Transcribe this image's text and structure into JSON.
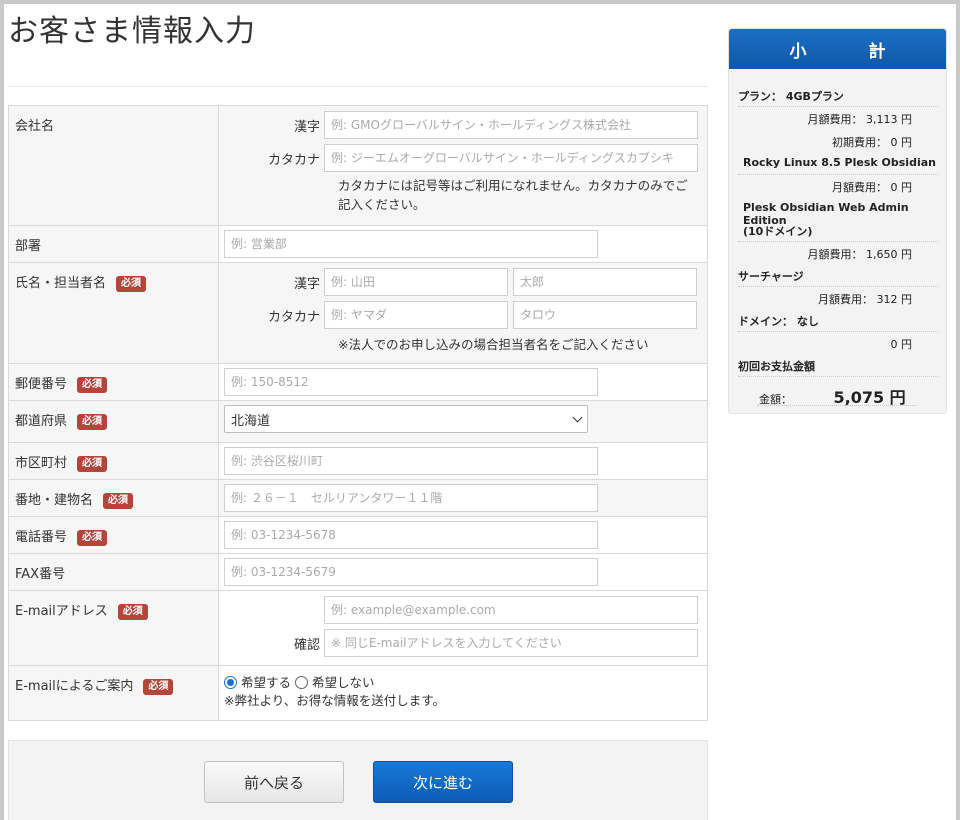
{
  "page": {
    "title": "お客さま情報入力"
  },
  "form": {
    "company": {
      "label": "会社名",
      "kanji_label": "漢字",
      "kanji_placeholder": "例: GMOグローバルサイン・ホールディングス株式会社",
      "kana_label": "カタカナ",
      "kana_placeholder": "例: ジーエムオーグローバルサイン・ホールディングスカブシキ",
      "note": "カタカナには記号等はご利用になれません。カタカナのみでご記入ください。"
    },
    "department": {
      "label": "部署",
      "placeholder": "例: 営業部"
    },
    "name": {
      "label": "氏名・担当者名",
      "required": "必須",
      "kanji_label": "漢字",
      "last_placeholder": "例: 山田",
      "first_placeholder": "太郎",
      "kana_label": "カタカナ",
      "last_kana_placeholder": "例: ヤマダ",
      "first_kana_placeholder": "タロウ",
      "note": "※法人でのお申し込みの場合担当者名をご記入ください"
    },
    "postal": {
      "label": "郵便番号",
      "required": "必須",
      "placeholder": "例: 150-8512"
    },
    "prefecture": {
      "label": "都道府県",
      "required": "必須",
      "value": "北海道"
    },
    "city": {
      "label": "市区町村",
      "required": "必須",
      "placeholder": "例: 渋谷区桜川町"
    },
    "address": {
      "label": "番地・建物名",
      "required": "必須",
      "placeholder": "例: ２６－１　セルリアンタワー１１階"
    },
    "phone": {
      "label": "電話番号",
      "required": "必須",
      "placeholder": "例: 03-1234-5678"
    },
    "fax": {
      "label": "FAX番号",
      "placeholder": "例: 03-1234-5679"
    },
    "email": {
      "label": "E-mailアドレス",
      "required": "必須",
      "placeholder": "例: example@example.com",
      "confirm_label": "確認",
      "confirm_placeholder": "※ 同じE-mailアドレスを入力してください"
    },
    "newsletter": {
      "label": "E-mailによるご案内",
      "required": "必須",
      "option_yes": "希望する",
      "option_no": "希望しない",
      "selected": "希望する",
      "note": "※弊社より、お得な情報を送付します。"
    }
  },
  "buttons": {
    "back": "前へ戻る",
    "next": "次に進む"
  },
  "summary": {
    "title": "小 計",
    "plan_label": "プラン：",
    "plan_value": "4GBプラン",
    "plan_monthly": "月額費用： 3,113 円",
    "plan_initial": "初期費用： 0 円",
    "os": "Rocky Linux 8.5 Plesk Obsidian",
    "os_monthly": "月額費用： 0 円",
    "plesk_line1": "Plesk Obsidian Web Admin Edition",
    "plesk_line2": "(10ドメイン)",
    "plesk_monthly": "月額費用： 1,650 円",
    "surcharge_label": "サーチャージ",
    "surcharge_monthly": "月額費用： 312 円",
    "domain_label": "ドメイン： なし",
    "domain_price": "0 円",
    "first_payment_label": "初回お支払金額",
    "amount_label": "金額：",
    "amount_value": "5,075 円"
  },
  "colors": {
    "primary": "#0b5bb5",
    "required_badge": "#b5453b",
    "radio_selected": "#1a73c9"
  }
}
